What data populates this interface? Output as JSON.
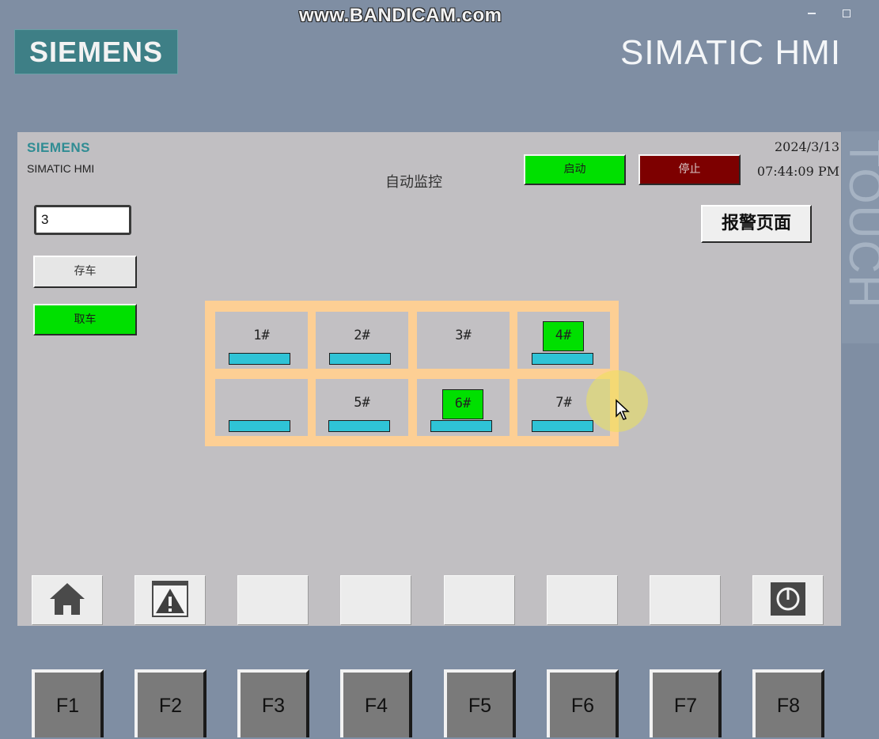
{
  "watermark": "www.BANDICAM.com",
  "bezel": {
    "brand": "SIEMENS",
    "product": "SIMATIC HMI",
    "side_text": "TOUCH"
  },
  "screen": {
    "brand": "SIEMENS",
    "product": "SIMATIC HMI",
    "title": "自动监控",
    "date": "2024/3/13",
    "time": "07:44:09 PM",
    "start_label": "启动",
    "stop_label": "停止",
    "alarm_page_label": "报警页面",
    "slot_input_value": "3",
    "store_label": "存车",
    "retrieve_label": "取车"
  },
  "parking": {
    "slots": [
      {
        "label": "1#",
        "occupied": false
      },
      {
        "label": "2#",
        "occupied": false
      },
      {
        "label": "3#",
        "occupied": false
      },
      {
        "label": "4#",
        "occupied": true
      },
      {
        "label": "",
        "occupied": false
      },
      {
        "label": "5#",
        "occupied": false
      },
      {
        "label": "6#",
        "occupied": true
      },
      {
        "label": "7#",
        "occupied": false
      }
    ]
  },
  "function_keys": [
    "F1",
    "F2",
    "F3",
    "F4",
    "F5",
    "F6",
    "F7",
    "F8"
  ],
  "colors": {
    "bezel": "#7f8ea3",
    "screen_bg": "#c1bfc2",
    "start_green": "#00e000",
    "stop_red": "#7d0000",
    "grid_frame": "#fdcf94",
    "pallet": "#2fc3d6",
    "brand_teal": "#3e7f86"
  },
  "icons": {
    "softkey_1": "home-icon",
    "softkey_2": "warning-icon",
    "softkey_8": "power-icon"
  }
}
